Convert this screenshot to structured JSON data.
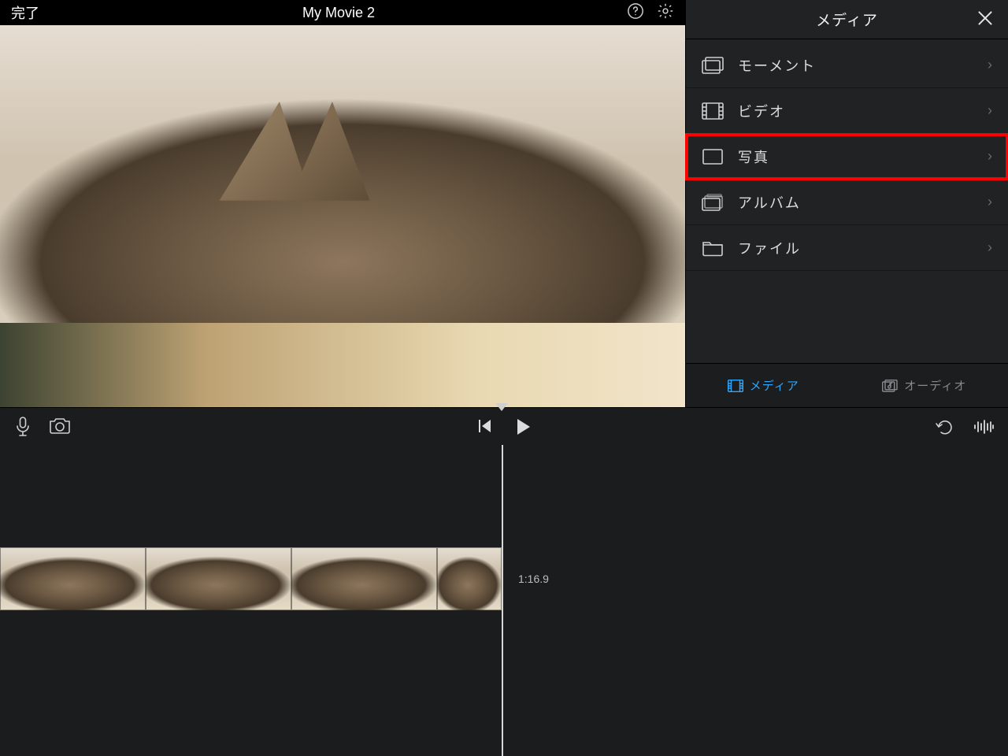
{
  "titlebar": {
    "done": "完了",
    "title": "My Movie 2"
  },
  "mediaPanel": {
    "header": "メディア",
    "items": [
      {
        "label": "モーメント",
        "icon": "moments-icon",
        "highlight": false
      },
      {
        "label": "ビデオ",
        "icon": "video-icon",
        "highlight": false
      },
      {
        "label": "写真",
        "icon": "photo-icon",
        "highlight": true
      },
      {
        "label": "アルバム",
        "icon": "album-icon",
        "highlight": false
      },
      {
        "label": "ファイル",
        "icon": "file-icon",
        "highlight": false
      }
    ],
    "tabs": {
      "media": "メディア",
      "audio": "オーディオ"
    }
  },
  "timeline": {
    "currentTime": "1:16.9"
  }
}
